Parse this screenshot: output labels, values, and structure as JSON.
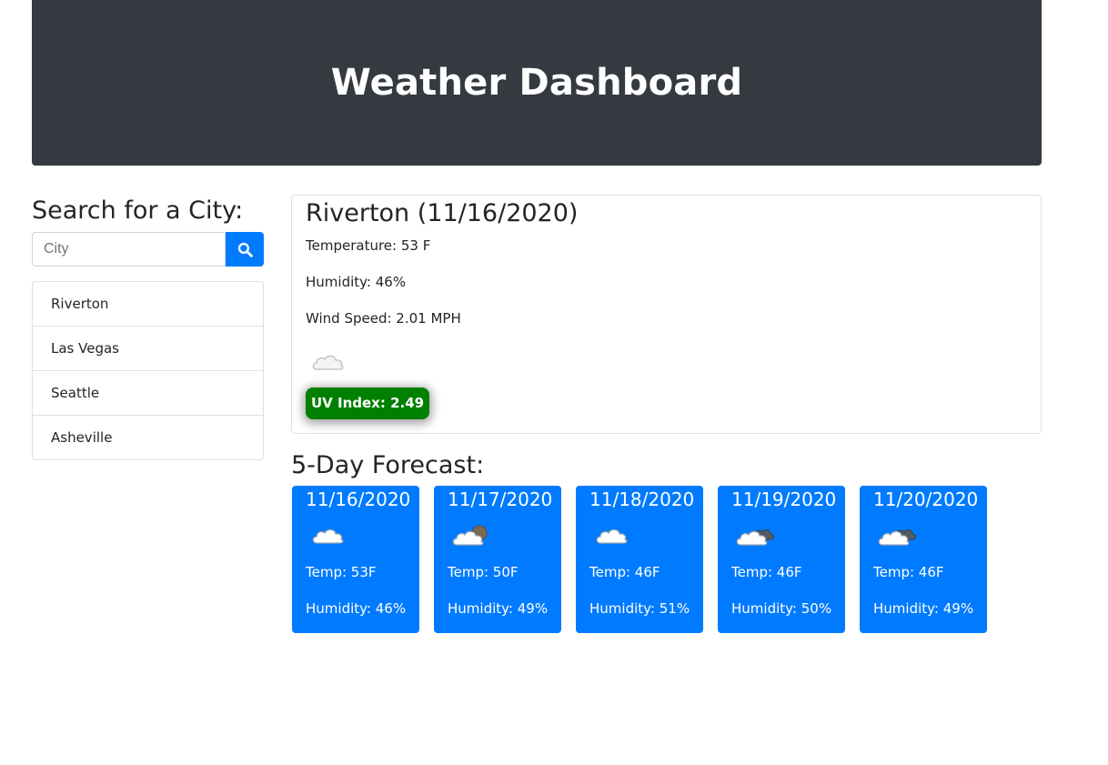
{
  "header": {
    "title": "Weather Dashboard"
  },
  "sidebar": {
    "heading": "Search for a City:",
    "search": {
      "placeholder": "City",
      "value": ""
    },
    "button_icon": "search-icon",
    "history": [
      {
        "label": "Riverton"
      },
      {
        "label": "Las Vegas"
      },
      {
        "label": "Seattle"
      },
      {
        "label": "Asheville"
      }
    ]
  },
  "current": {
    "title": "Riverton (11/16/2020)",
    "temperature": "Temperature: 53 F",
    "humidity": "Humidity: 46%",
    "wind": "Wind Speed: 2.01 MPH",
    "icon": "cloud-icon",
    "uv": "UV Index: 2.49",
    "uv_color": "#008000"
  },
  "forecast": {
    "heading": "5-Day Forecast:",
    "card_color": "#007bff",
    "days": [
      {
        "date": "11/16/2020",
        "icon": "cloud-icon",
        "temp": "Temp: 53F",
        "humidity": "Humidity: 46%"
      },
      {
        "date": "11/17/2020",
        "icon": "cloud-moon-icon",
        "temp": "Temp: 50F",
        "humidity": "Humidity: 49%"
      },
      {
        "date": "11/18/2020",
        "icon": "cloud-icon",
        "temp": "Temp: 46F",
        "humidity": "Humidity: 51%"
      },
      {
        "date": "11/19/2020",
        "icon": "broken-clouds-icon",
        "temp": "Temp: 46F",
        "humidity": "Humidity: 50%"
      },
      {
        "date": "11/20/2020",
        "icon": "broken-clouds-icon",
        "temp": "Temp: 46F",
        "humidity": "Humidity: 49%"
      }
    ]
  }
}
